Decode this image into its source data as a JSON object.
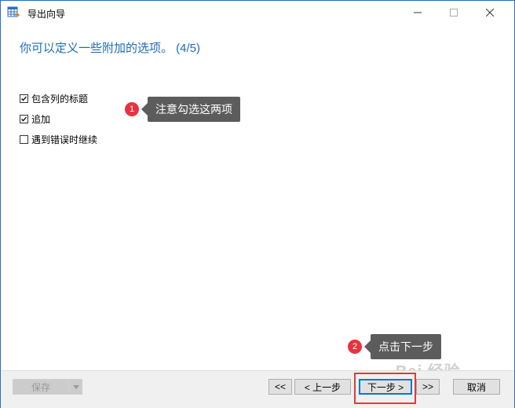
{
  "window": {
    "title": "导出向导",
    "controls": {
      "minimize": "minimize",
      "maximize": "maximize",
      "close": "close"
    }
  },
  "heading": "你可以定义一些附加的选项。 (4/5)",
  "options": [
    {
      "label": "包含列的标题",
      "checked": true
    },
    {
      "label": "追加",
      "checked": true
    },
    {
      "label": "遇到错误时继续",
      "checked": false
    }
  ],
  "annotations": [
    {
      "number": "1",
      "text": "注意勾选这两项"
    },
    {
      "number": "2",
      "text": "点击下一步"
    }
  ],
  "footer": {
    "save_label": "保存",
    "first_label": "<<",
    "prev_label": "< 上一步",
    "next_label": "下一步 >",
    "last_label": ">>",
    "cancel_label": "取消"
  },
  "watermark": "Bai 经验",
  "colors": {
    "accent": "#1e6bb8",
    "badge": "#e8323f",
    "callout_bg": "#5c5c5c",
    "highlight": "#e23a3a"
  },
  "icons": [
    "table-export-icon",
    "minimize-icon",
    "maximize-icon",
    "close-icon",
    "check-icon",
    "dropdown-arrow-icon"
  ]
}
